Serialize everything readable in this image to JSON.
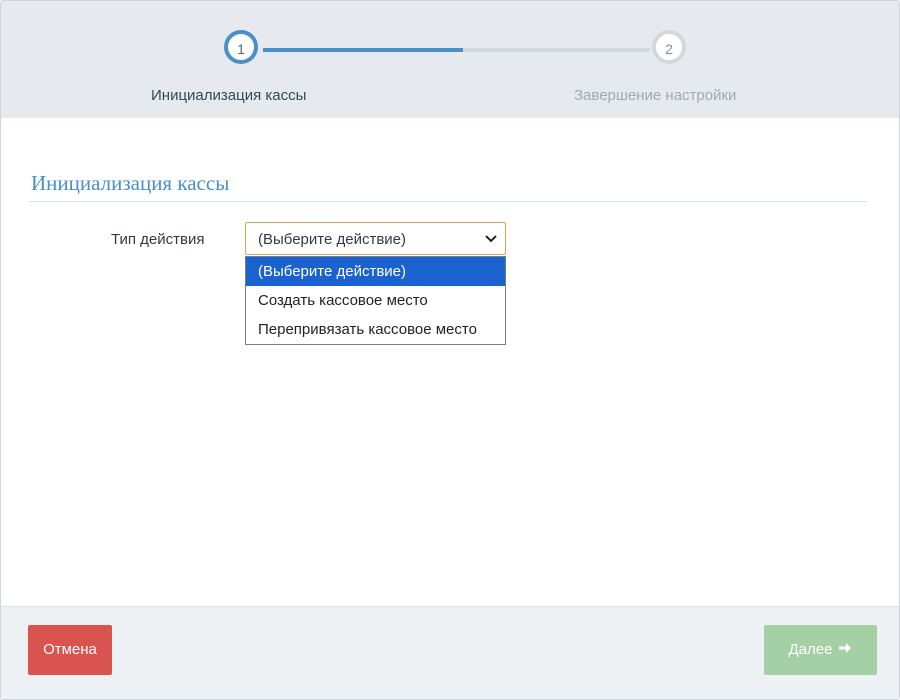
{
  "stepper": {
    "steps": [
      {
        "number": "1",
        "label": "Инициализация кассы"
      },
      {
        "number": "2",
        "label": "Завершение настройки"
      }
    ]
  },
  "section": {
    "title": "Инициализация кассы"
  },
  "form": {
    "action_type_label": "Тип действия",
    "action_select": {
      "value": "(Выберите действие)",
      "options": [
        "(Выберите действие)",
        "Создать кассовое место",
        "Перепривязать кассовое место"
      ]
    }
  },
  "footer": {
    "cancel_label": "Отмена",
    "next_label": "Далее"
  },
  "colors": {
    "accent": "#4a8fc7",
    "cancel": "#d9534f",
    "next_disabled": "#a5d0a5",
    "option_selected": "#1a62cf"
  }
}
